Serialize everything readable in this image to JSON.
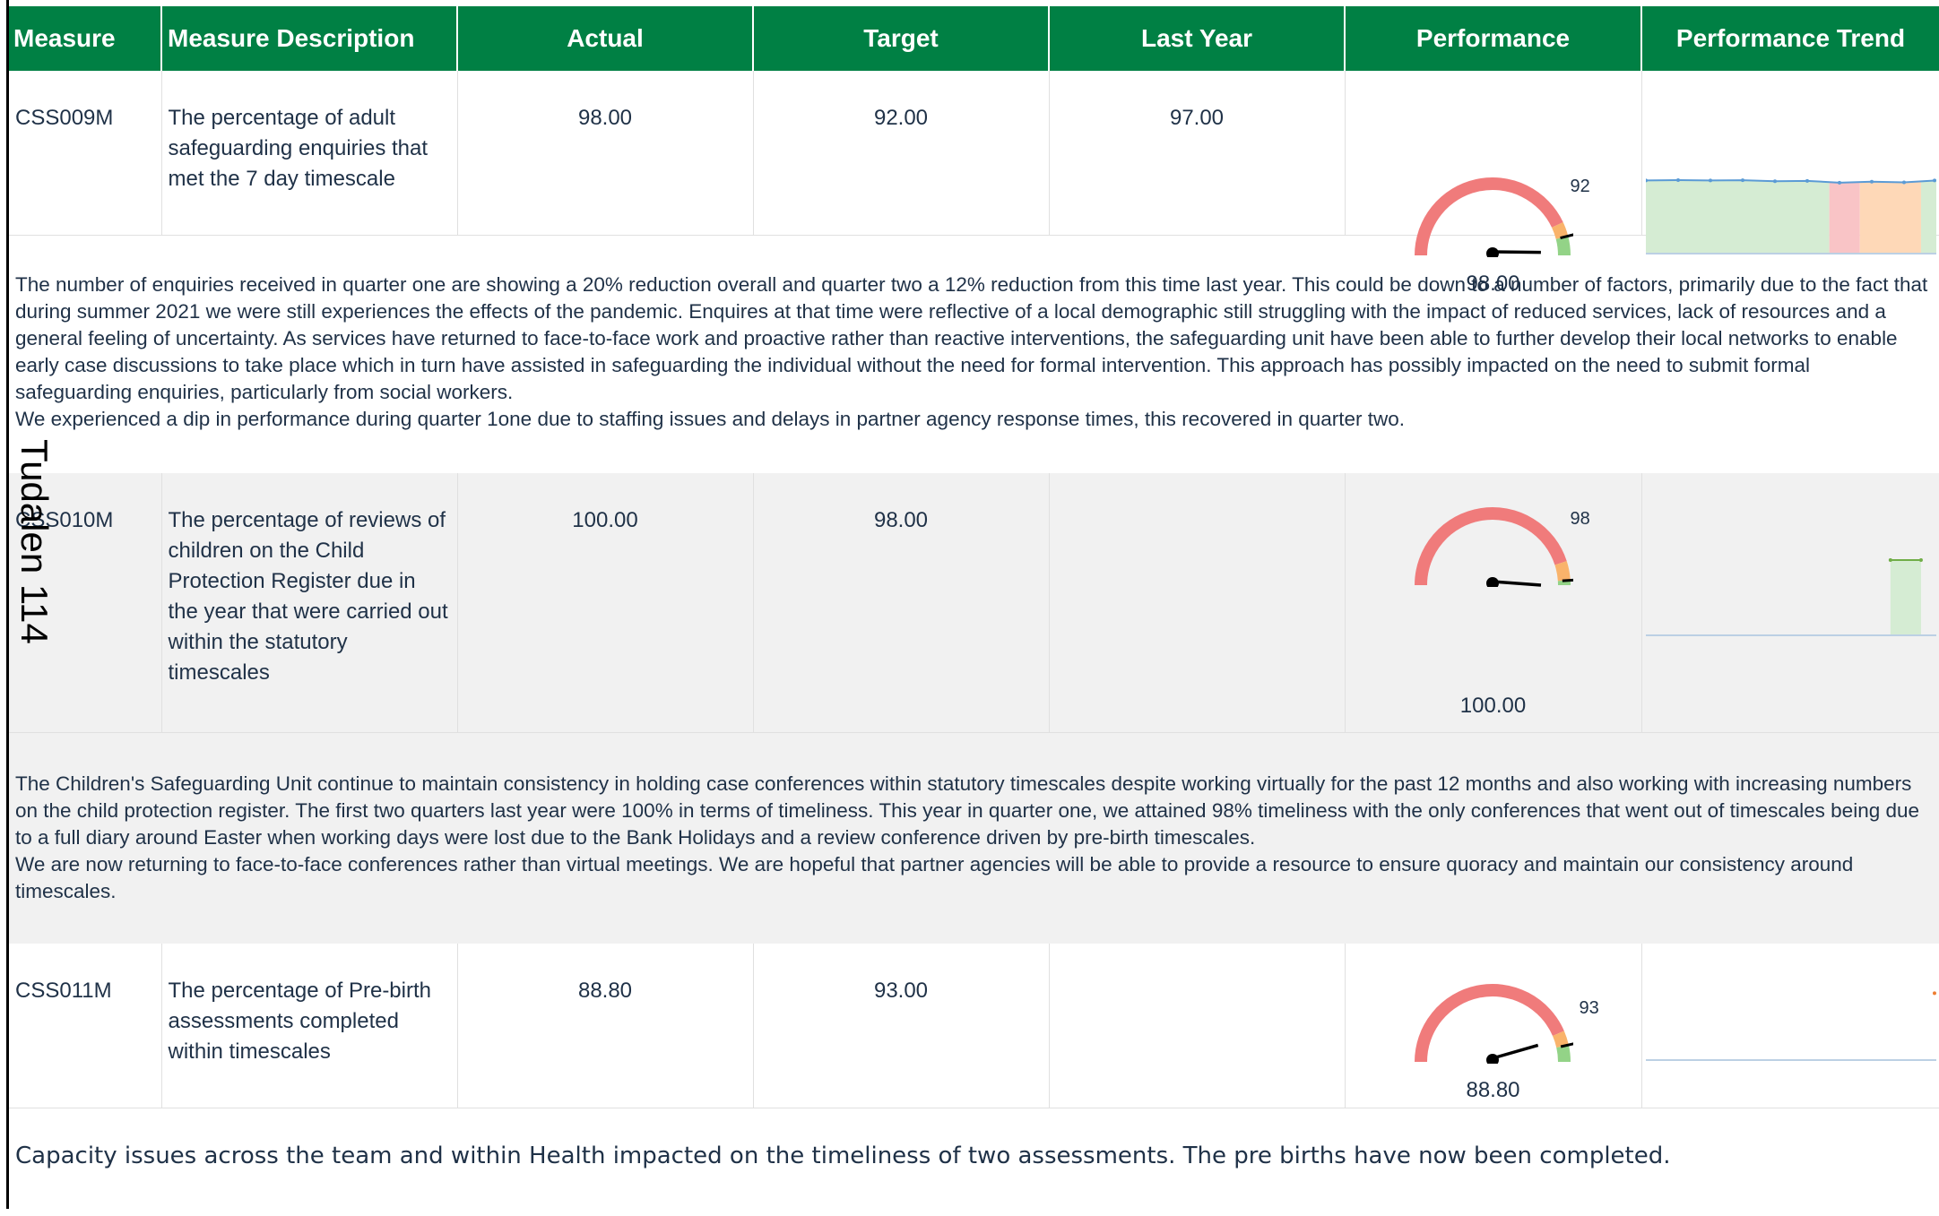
{
  "headers": {
    "measure": "Measure",
    "description": "Measure Description",
    "actual": "Actual",
    "target": "Target",
    "last_year": "Last Year",
    "performance": "Performance",
    "trend": "Performance Trend"
  },
  "measures": [
    {
      "code": "CSS009M",
      "description": "The percentage of adult safeguarding enquiries that met the 7 day timescale",
      "actual": "98.00",
      "target": "92.00",
      "last_year": "97.00",
      "gauge": {
        "value": 98.0,
        "value_label": "98.00",
        "target": 92,
        "target_label": "92",
        "min": 0,
        "max": 100
      },
      "trend": {
        "line_color": "#5b9bd5",
        "segments": [
          {
            "from": 0,
            "to": 6,
            "color": "#d5ecd3"
          },
          {
            "from": 6,
            "to": 7,
            "color": "#f9c4c6"
          },
          {
            "from": 7,
            "to": 9,
            "color": "#fed8b7"
          },
          {
            "from": 9,
            "to": 9.5,
            "color": "#d5ecd3"
          }
        ],
        "values": [
          98.6,
          98.8,
          98.6,
          98.7,
          98.1,
          98.3,
          97.1,
          97.8,
          97.3,
          98.6
        ],
        "ylim": [
          50,
          100
        ]
      },
      "note": [
        "The number of enquiries received in quarter one are showing a 20% reduction overall and quarter two a 12% reduction from this time last year. This could be down to a number of factors, primarily due to the fact that during summer 2021 we were still experiences the effects of the pandemic. Enquires at that time were reflective of a local demographic still struggling with the impact of reduced services, lack of resources and a general feeling of uncertainty. As services have returned to face-to-face work and proactive rather than reactive interventions, the safeguarding unit have been able to further develop their local networks to enable early case discussions to take place which in turn have assisted in safeguarding the individual without the need for formal intervention. This approach has possibly impacted on the need to submit formal safeguarding enquiries, particularly from social workers.",
        "We experienced a dip in performance during quarter 1one due to staffing issues and delays in partner agency response times, this recovered in quarter two."
      ]
    },
    {
      "code": "CSS010M",
      "description": "The percentage of reviews of children on the Child Protection Register due in the year that were carried out within the statutory timescales",
      "actual": "100.00",
      "target": "98.00",
      "last_year": "",
      "gauge": {
        "value": 100.0,
        "value_label": "100.00",
        "target": 98,
        "target_label": "98",
        "min": 0,
        "max": 100
      },
      "trend": {
        "line_color": "#70ad47",
        "segments": [
          {
            "from": 8,
            "to": 9,
            "color": "#d5ecd3"
          }
        ],
        "values": [
          100,
          100
        ],
        "value_x": [
          8,
          9
        ],
        "ylim": [
          0,
          100
        ]
      },
      "note": [
        "The Children's Safeguarding Unit continue to maintain consistency in holding case conferences within statutory timescales despite working virtually for the past 12 months and also working with increasing numbers on the child protection register. The first two quarters last year were 100% in terms of timeliness. This year in quarter one, we attained 98% timeliness with the only conferences that went out of timescales being due to a full diary around Easter when working days were lost due to the Bank Holidays and a review conference driven by pre-birth timescales.",
        "We are now returning to face-to-face conferences rather than virtual meetings. We are hopeful that partner agencies will be able to provide a resource to ensure quoracy and maintain our consistency around timescales."
      ]
    },
    {
      "code": "CSS011M",
      "description": "The percentage of Pre-birth assessments completed within timescales",
      "actual": "88.80",
      "target": "93.00",
      "last_year": "",
      "gauge": {
        "value": 88.8,
        "value_label": "88.80",
        "target": 93,
        "target_label": "93",
        "min": 0,
        "max": 100
      },
      "trend": {
        "line_color": "#ed7d31",
        "segments": [],
        "values": [
          88.8
        ],
        "value_x": [
          9.5
        ],
        "ylim": [
          0,
          100
        ]
      },
      "note": [
        "Capacity issues across the team and within Health impacted on the timeliness of two assessments. The pre births have now been completed."
      ]
    }
  ],
  "watermark": "Tudalen 114",
  "colors": {
    "header_bg": "#008044",
    "gauge_red": "#f07b7b",
    "gauge_amber": "#f9b36b",
    "gauge_green": "#93d387",
    "text": "#1f3147"
  }
}
